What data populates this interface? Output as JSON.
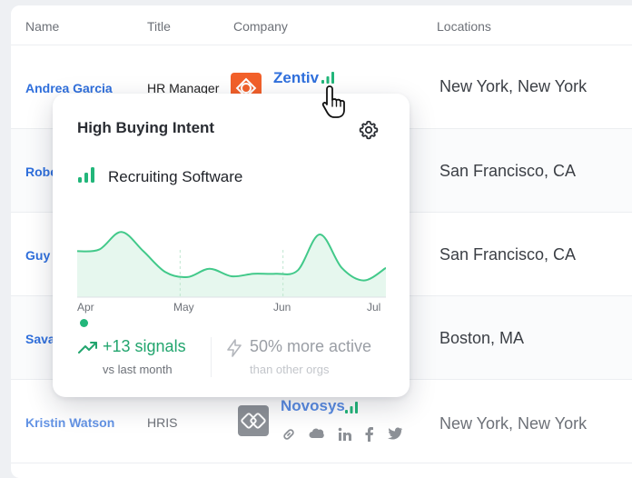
{
  "table": {
    "headers": {
      "name": "Name",
      "title": "Title",
      "company": "Company",
      "locations": "Locations"
    },
    "rows": [
      {
        "name": "Andrea Garcia",
        "title": "HR Manager",
        "company": "Zentiv",
        "location": "New York, New York"
      },
      {
        "name": "Robe",
        "title": "",
        "company": "",
        "location": "San Francisco, CA"
      },
      {
        "name": "Guy",
        "title": "",
        "company": "",
        "location": "San Francisco, CA"
      },
      {
        "name": "Sava",
        "title": "",
        "company": "",
        "location": "Boston, MA"
      },
      {
        "name": "Kristin Watson",
        "title": "HRIS",
        "company": "Novosys",
        "location": "New York, New York"
      }
    ]
  },
  "popover": {
    "title": "High Buying Intent",
    "topic": "Recruiting Software",
    "months": [
      "Apr",
      "May",
      "Jun",
      "Jul"
    ],
    "signals": "+13 signals",
    "signals_sub": "vs last month",
    "active": "50% more active",
    "active_sub": "than other orgs"
  },
  "chart_data": {
    "type": "area",
    "categories": [
      "Apr",
      "May",
      "Jun",
      "Jul"
    ],
    "series": [
      {
        "values": [
          55,
          57,
          78,
          55,
          30,
          24,
          34,
          25,
          28,
          28,
          32,
          75,
          35,
          20,
          35
        ]
      }
    ],
    "ylim": [
      0,
      100
    ],
    "grid": false
  },
  "icons": {
    "gear": "gear-icon",
    "signal_bars": "signal-bars-icon",
    "trend": "trend-up-icon",
    "bolt": "bolt-icon",
    "cursor": "hand-pointer-icon",
    "social": [
      "link-icon",
      "salesforce-icon",
      "linkedin-icon",
      "facebook-icon",
      "twitter-icon"
    ]
  },
  "colors": {
    "link": "#2f6fdc",
    "signal": "#22b67a",
    "chart_line": "#42c98a",
    "chart_fill": "#e6f7ee",
    "zentiv_logo": "#f2602a"
  }
}
